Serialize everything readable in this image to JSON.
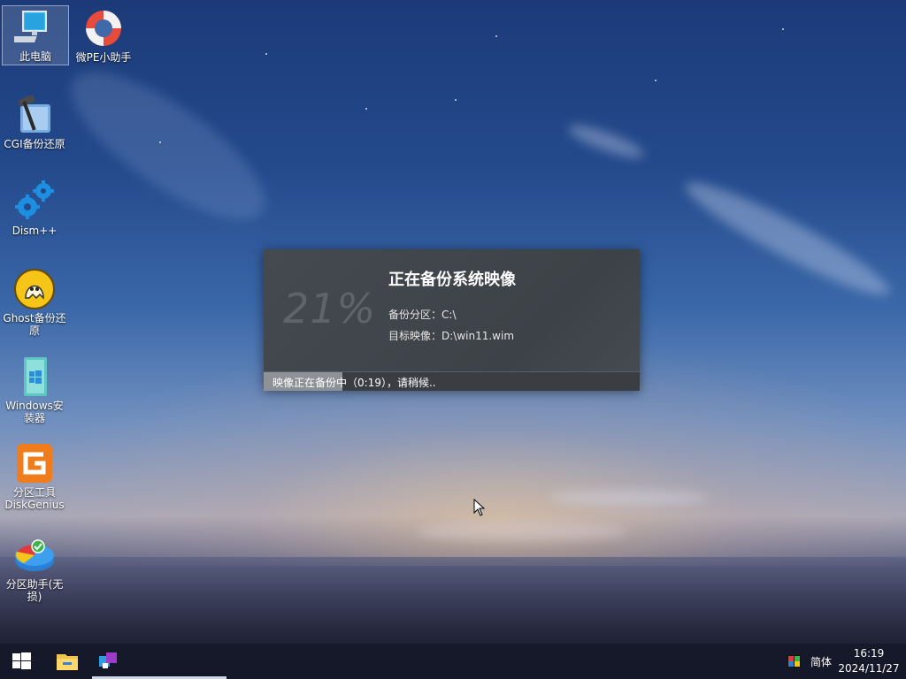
{
  "desktop": {
    "icons": [
      {
        "label": "此电脑",
        "icon": "computer-icon"
      },
      {
        "label": "微PE小助手",
        "icon": "lifebuoy-icon"
      },
      {
        "label": "CGI备份还原",
        "icon": "hammer-icon"
      },
      {
        "label": "Dism++",
        "icon": "gears-icon"
      },
      {
        "label": "Ghost备份还原",
        "icon": "ghost-icon"
      },
      {
        "label": "Windows安装器",
        "icon": "windows-installer-icon"
      },
      {
        "label": "分区工具DiskGenius",
        "icon": "diskgenius-icon"
      },
      {
        "label": "分区助手(无损)",
        "icon": "partition-assistant-icon"
      }
    ]
  },
  "dialog": {
    "percent_text": "21%",
    "progress": 0.21,
    "title": "正在备份系统映像",
    "source_label": "备份分区：",
    "source_value": "C:\\",
    "target_label": "目标映像：",
    "target_value": "D:\\win11.wim",
    "status": "映像正在备份中（0:19），请稍候.."
  },
  "taskbar": {
    "start_icon": "windows-start-icon",
    "pinned": [
      "file-explorer-icon",
      "backup-app-icon"
    ],
    "tray": {
      "ime_icon": "ime-color-icon",
      "language": "简体"
    },
    "clock": {
      "time": "16:19",
      "date": "2024/11/27"
    }
  }
}
